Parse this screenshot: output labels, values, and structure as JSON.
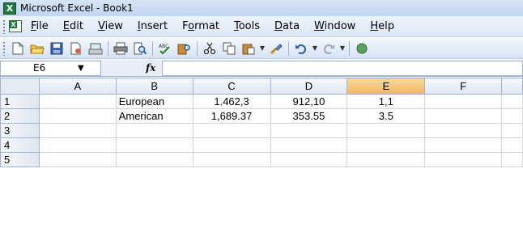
{
  "window": {
    "title": "Microsoft Excel - Book1"
  },
  "menu": [
    {
      "key": "F",
      "rest": "ile"
    },
    {
      "key": "E",
      "rest": "dit"
    },
    {
      "key": "V",
      "rest": "iew"
    },
    {
      "key": "I",
      "rest": "nsert"
    },
    {
      "pre": "F",
      "key": "o",
      "rest": "rmat"
    },
    {
      "key": "T",
      "rest": "ools"
    },
    {
      "key": "D",
      "rest": "ata"
    },
    {
      "key": "W",
      "rest": "indow"
    },
    {
      "key": "H",
      "rest": "elp"
    }
  ],
  "namebox": {
    "value": "E6"
  },
  "formula": {
    "fx_label": "fx",
    "value": ""
  },
  "columns": [
    "A",
    "B",
    "C",
    "D",
    "E",
    "F"
  ],
  "selected_column": "E",
  "rows": [
    {
      "num": "1",
      "cells": [
        "",
        "European",
        "1.462,3",
        "912,10",
        "1,1",
        ""
      ]
    },
    {
      "num": "2",
      "cells": [
        "",
        "American",
        "1,689.37",
        "353.55",
        "3.5",
        ""
      ]
    },
    {
      "num": "3",
      "cells": [
        "",
        "",
        "",
        "",
        "",
        ""
      ]
    },
    {
      "num": "4",
      "cells": [
        "",
        "",
        "",
        "",
        "",
        ""
      ]
    },
    {
      "num": "5",
      "cells": [
        "",
        "",
        "",
        "",
        "",
        ""
      ]
    }
  ],
  "colors": {
    "title_bg": "#c2d5f0",
    "selected_header": "#f1b75f",
    "grid_line": "#d4d4d4"
  }
}
